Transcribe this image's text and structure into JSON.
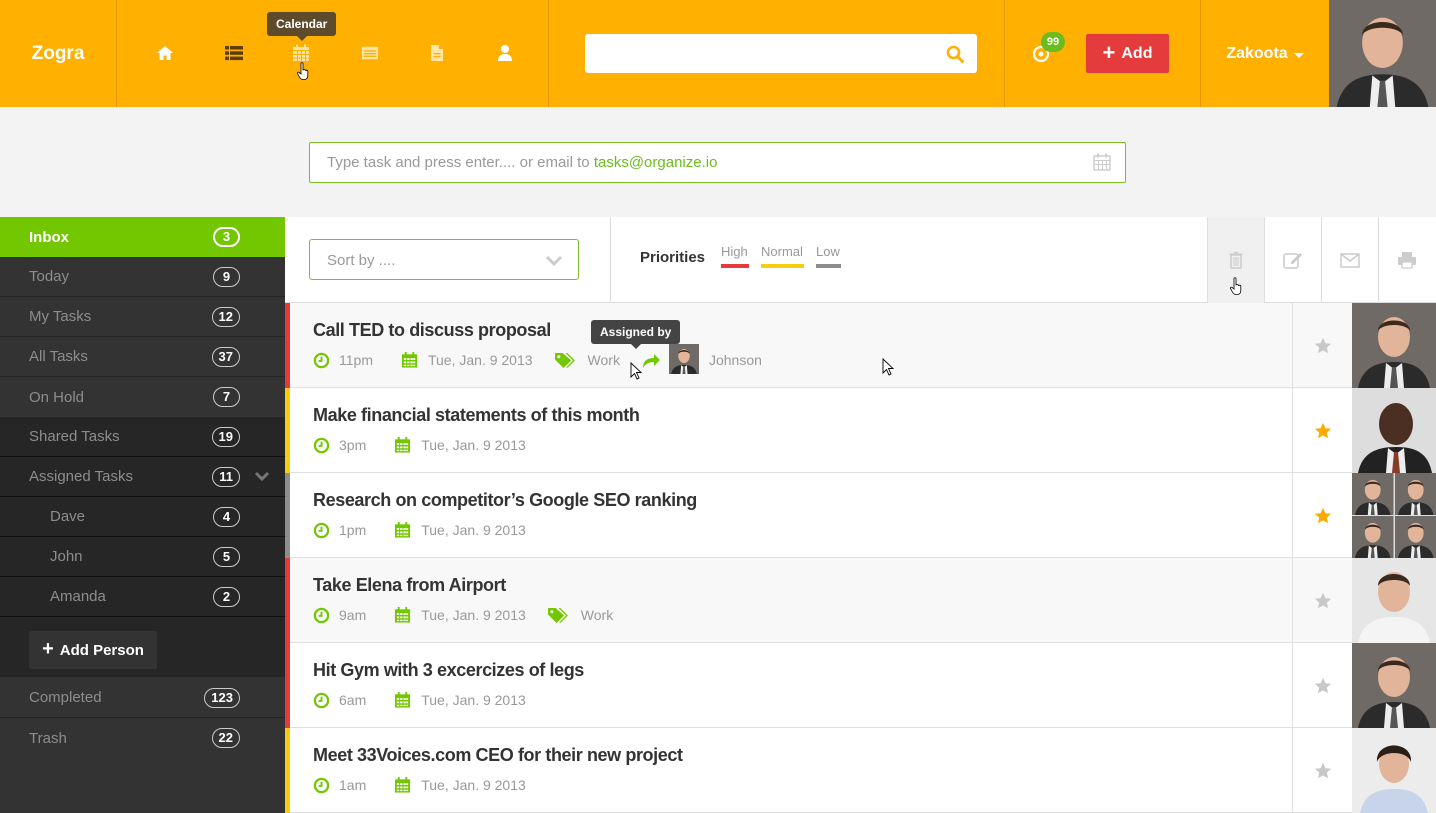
{
  "header": {
    "logo": "Zogra",
    "nav": [
      {
        "name": "home",
        "icon": "home-icon"
      },
      {
        "name": "list",
        "icon": "list-icon",
        "active": true
      },
      {
        "name": "calendar",
        "icon": "calendar-icon",
        "tooltip": "Calendar"
      },
      {
        "name": "notes",
        "icon": "card-icon"
      },
      {
        "name": "documents",
        "icon": "document-icon"
      },
      {
        "name": "profile",
        "icon": "user-icon"
      }
    ],
    "search": {
      "placeholder": "",
      "value": ""
    },
    "notifications_count": "99",
    "add_label": "Add",
    "user_name": "Zakoota"
  },
  "quick_add": {
    "placeholder": "Type task and press enter.... or email to ",
    "email": "tasks@organize.io"
  },
  "sidebar": {
    "items": [
      {
        "label": "Inbox",
        "count": "3"
      },
      {
        "label": "Today",
        "count": "9"
      },
      {
        "label": "My Tasks",
        "count": "12"
      },
      {
        "label": "All Tasks",
        "count": "37"
      },
      {
        "label": "On Hold",
        "count": "7"
      },
      {
        "label": "Shared Tasks",
        "count": "19"
      },
      {
        "label": "Assigned Tasks",
        "count": "11"
      },
      {
        "label": "Dave",
        "count": "4"
      },
      {
        "label": "John",
        "count": "5"
      },
      {
        "label": "Amanda",
        "count": "2"
      },
      {
        "label": "Completed",
        "count": "123"
      },
      {
        "label": "Trash",
        "count": "22"
      }
    ],
    "add_person_label": "Add Person"
  },
  "toolbar": {
    "sort_placeholder": "Sort by ....",
    "priorities_label": "Priorities",
    "priorities": [
      {
        "label": "High",
        "color": "#e43c3c"
      },
      {
        "label": "Normal",
        "color": "#f7cd12"
      },
      {
        "label": "Low",
        "color": "#8d8d8d"
      }
    ],
    "actions": [
      "delete",
      "edit",
      "email",
      "print"
    ]
  },
  "colors": {
    "brand": "#ffb000",
    "accent_green": "#73c700",
    "add_red": "#e43c3c",
    "star_active": "#ffaa00",
    "star_inactive": "#c8c8c8"
  },
  "tasks": [
    {
      "title": "Call TED to discuss proposal",
      "time": "11pm",
      "date": "Tue, Jan. 9 2013",
      "tag": "Work",
      "priority": "High",
      "starred": false,
      "assigned_by": "Johnson",
      "assigned_tooltip": "Assigned by"
    },
    {
      "title": "Make financial statements of this month",
      "time": "3pm",
      "date": "Tue, Jan. 9 2013",
      "tag": null,
      "priority": "Normal",
      "starred": true
    },
    {
      "title": "Research on competitor’s Google SEO ranking",
      "time": "1pm",
      "date": "Tue, Jan. 9 2013",
      "tag": null,
      "priority": "Low",
      "starred": true,
      "shared": true
    },
    {
      "title": "Take Elena from Airport",
      "time": "9am",
      "date": "Tue, Jan. 9 2013",
      "tag": "Work",
      "priority": "High",
      "starred": false
    },
    {
      "title": "Hit Gym with 3 excercizes of legs",
      "time": "6am",
      "date": "Tue, Jan. 9 2013",
      "tag": null,
      "priority": "High",
      "starred": false
    },
    {
      "title": "Meet 33Voices.com CEO for their new project",
      "time": "1am",
      "date": "Tue, Jan. 9 2013",
      "tag": null,
      "priority": "Normal",
      "starred": false
    }
  ]
}
